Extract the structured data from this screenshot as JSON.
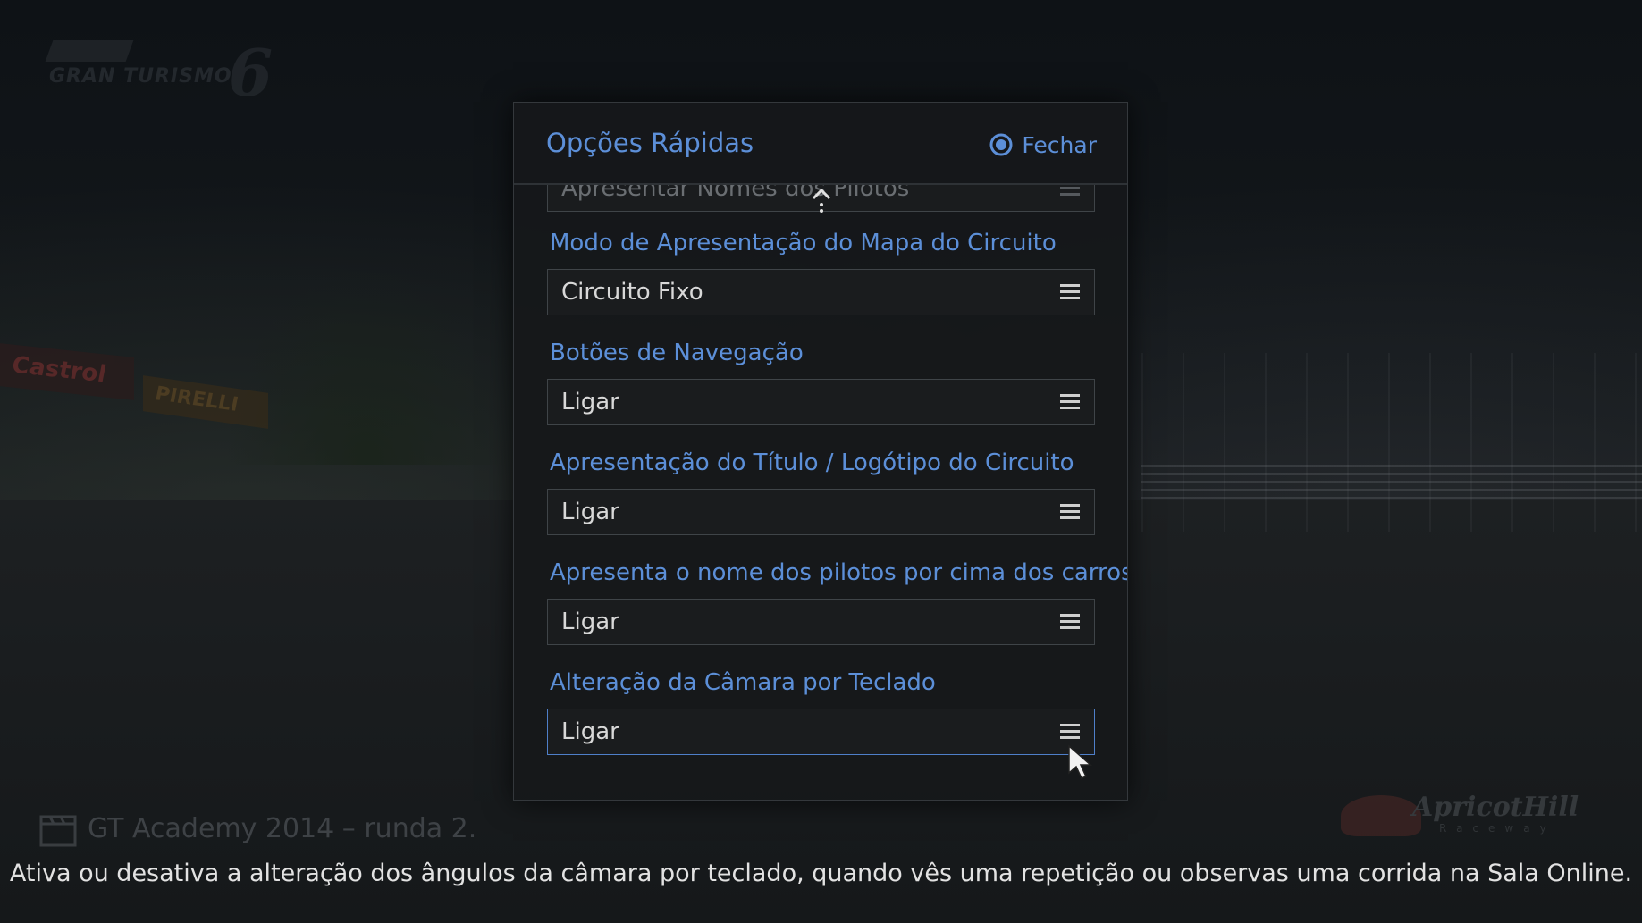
{
  "game_logo": {
    "text": "GRAN TURISMO",
    "number": "6"
  },
  "dialog": {
    "title": "Opções Rápidas",
    "close_label": "Fechar",
    "close_icon": "circle-button-icon",
    "accent_color": "#5c8fd8",
    "options": [
      {
        "label": "",
        "value": "Apresentar Nomes dos Pilotos",
        "partially_visible": true
      },
      {
        "label": "Modo de Apresentação do Mapa do Circuito",
        "value": "Circuito Fixo"
      },
      {
        "label": "Botões de Navegação",
        "value": "Ligar"
      },
      {
        "label": "Apresentação do Título / Logótipo do Circuito",
        "value": "Ligar"
      },
      {
        "label": "Apresenta o nome dos pilotos por cima dos carros",
        "value": "Ligar"
      },
      {
        "label": "Alteração da Câmara por Teclado",
        "value": "Ligar",
        "focused": true
      }
    ]
  },
  "background": {
    "sign_1": "Castrol",
    "sign_2": "PIRELLI"
  },
  "event": {
    "title": "GT Academy 2014 – runda 2."
  },
  "track_logo": {
    "name": "ApricotHill",
    "sub": "Raceway"
  },
  "help_text": "Ativa ou desativa a alteração dos ângulos da câmara por teclado, quando vês uma repetição ou observas uma corrida na Sala Online."
}
